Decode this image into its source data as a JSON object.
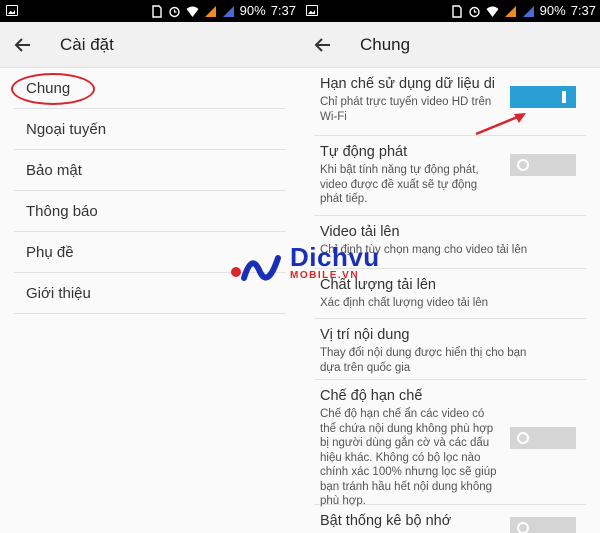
{
  "status_bar": {
    "battery": "90%",
    "time": "7:37"
  },
  "left_screen": {
    "title": "Cài đặt",
    "menu": [
      {
        "label": "Chung"
      },
      {
        "label": "Ngoại tuyến"
      },
      {
        "label": "Bảo mật"
      },
      {
        "label": "Thông báo"
      },
      {
        "label": "Phụ đề"
      },
      {
        "label": "Giới thiệu"
      }
    ]
  },
  "right_screen": {
    "title": "Chung",
    "settings": [
      {
        "title": "Hạn chế sử dụng dữ liệu di",
        "desc": "Chỉ phát trực tuyến video HD trên Wi-Fi",
        "toggle": "on"
      },
      {
        "title": "Tự động phát",
        "desc": "Khi bật tính năng tự động phát, video được đề xuất sẽ tự động phát tiếp.",
        "toggle": "off"
      },
      {
        "title": "Video tải lên",
        "desc": "Chỉ định tùy chọn mạng cho video tải lên"
      },
      {
        "title": "Chất lượng tải lên",
        "desc": "Xác định chất lượng video tải lên"
      },
      {
        "title": "Vị trí nội dung",
        "desc": "Thay đổi nội dung được hiển thị cho bạn dựa trên quốc gia"
      },
      {
        "title": "Chế độ hạn chế",
        "desc": "Chế độ hạn chế ẩn các video có thể chứa nội dung không phù hợp bị người dùng gắn cờ và các dấu hiệu khác. Không có bộ lọc nào chính xác 100% nhưng lọc sẽ giúp bạn tránh hầu hết nội dung không phù hợp.",
        "toggle": "off"
      },
      {
        "title": "Bật thống kê bộ nhớ",
        "toggle": "off"
      }
    ]
  },
  "watermark": {
    "text": "Dichvu",
    "sub": "MOBILE.VN"
  },
  "colors": {
    "toggle_on": "#2a9fd6",
    "toggle_off": "#d5d5d5",
    "highlight": "#d9262c",
    "arrow": "#d9262c"
  }
}
